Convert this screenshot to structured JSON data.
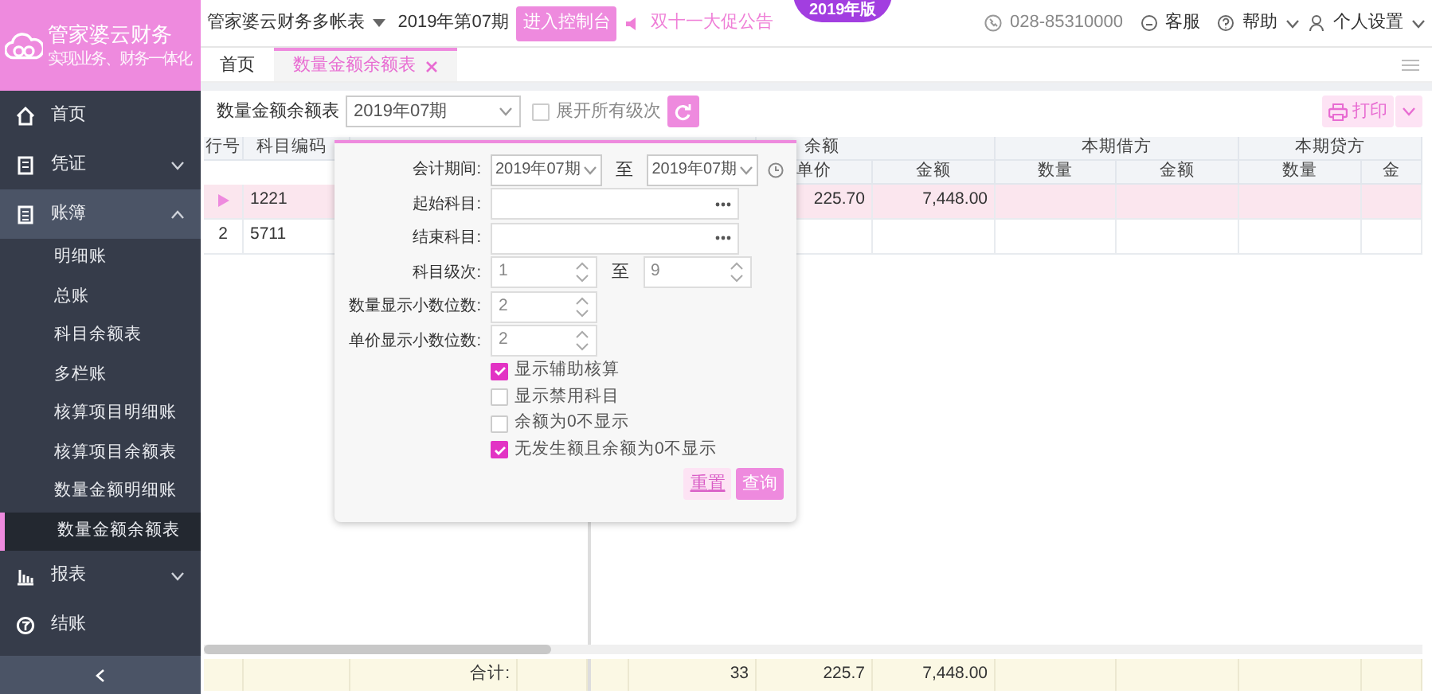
{
  "app": {
    "logo_title": "管家婆云财务",
    "logo_subtitle": "实现业务、财务一体化"
  },
  "topbar": {
    "account": "管家婆云财务多帐表",
    "period": "2019年第07期",
    "console_button": "进入控制台",
    "announcement": "双十一大促公告",
    "version_badge": "2019年版",
    "phone": "028-85310000",
    "service": "客服",
    "help": "帮助",
    "settings": "个人设置"
  },
  "sidebar": {
    "items": [
      {
        "label": "首页",
        "kind": "link"
      },
      {
        "label": "凭证",
        "kind": "group",
        "expanded": false
      },
      {
        "label": "账簿",
        "kind": "group",
        "expanded": true,
        "children": [
          {
            "label": "明细账",
            "selected": false
          },
          {
            "label": "总账",
            "selected": false
          },
          {
            "label": "科目余额表",
            "selected": false
          },
          {
            "label": "多栏账",
            "selected": false
          },
          {
            "label": "核算项目明细账",
            "selected": false
          },
          {
            "label": "核算项目余额表",
            "selected": false
          },
          {
            "label": "数量金额明细账",
            "selected": false
          },
          {
            "label": "数量金额余额表",
            "selected": true
          }
        ]
      },
      {
        "label": "报表",
        "kind": "group",
        "expanded": false
      },
      {
        "label": "结账",
        "kind": "link"
      }
    ]
  },
  "tabs": [
    {
      "label": "首页",
      "selected": false,
      "closable": false
    },
    {
      "label": "数量金额余额表",
      "selected": true,
      "closable": true
    }
  ],
  "toolbar": {
    "report_label": "数量金额余额表",
    "period_select": "2019年07期",
    "expand_all": {
      "label": "展开所有级次",
      "checked": false
    },
    "print_button": "打印"
  },
  "query_popup": {
    "fields": [
      {
        "kind": "range-select",
        "label": "会计期间:",
        "from": "2019年07期",
        "separator": "至",
        "to": "2019年07期"
      },
      {
        "kind": "picker",
        "label": "起始科目:"
      },
      {
        "kind": "picker",
        "label": "结束科目:"
      },
      {
        "kind": "range-spin",
        "label": "科目级次:",
        "from": "1",
        "separator": "至",
        "to": "9"
      },
      {
        "kind": "spin",
        "label": "数量显示小数位数:",
        "value": "2"
      },
      {
        "kind": "spin",
        "label": "单价显示小数位数:",
        "value": "2"
      }
    ],
    "options": [
      {
        "label": "显示辅助核算",
        "checked": true
      },
      {
        "label": "显示禁用科目",
        "checked": false
      },
      {
        "label": "余额为0不显示",
        "checked": false
      },
      {
        "label": "无发生额且余额为0不显示",
        "checked": true
      }
    ],
    "buttons": [
      {
        "label": "重置",
        "primary": false
      },
      {
        "label": "查询",
        "primary": true
      }
    ]
  },
  "table": {
    "header_row_1": [
      "行号",
      "科目编码",
      "余额",
      "本期借方",
      "本期贷方"
    ],
    "header_row_2": [
      "单价",
      "金额",
      "数量",
      "金额",
      "数量",
      "金"
    ],
    "rows": [
      {
        "selected": true,
        "code": "1221",
        "unit_price": "225.70",
        "amount": "7,448.00"
      },
      {
        "selected": false,
        "row_no": "2",
        "code": "5711"
      }
    ],
    "totals": {
      "label": "合计:",
      "quantity": "33",
      "unit_price": "225.7",
      "amount": "7,448.00"
    }
  }
}
